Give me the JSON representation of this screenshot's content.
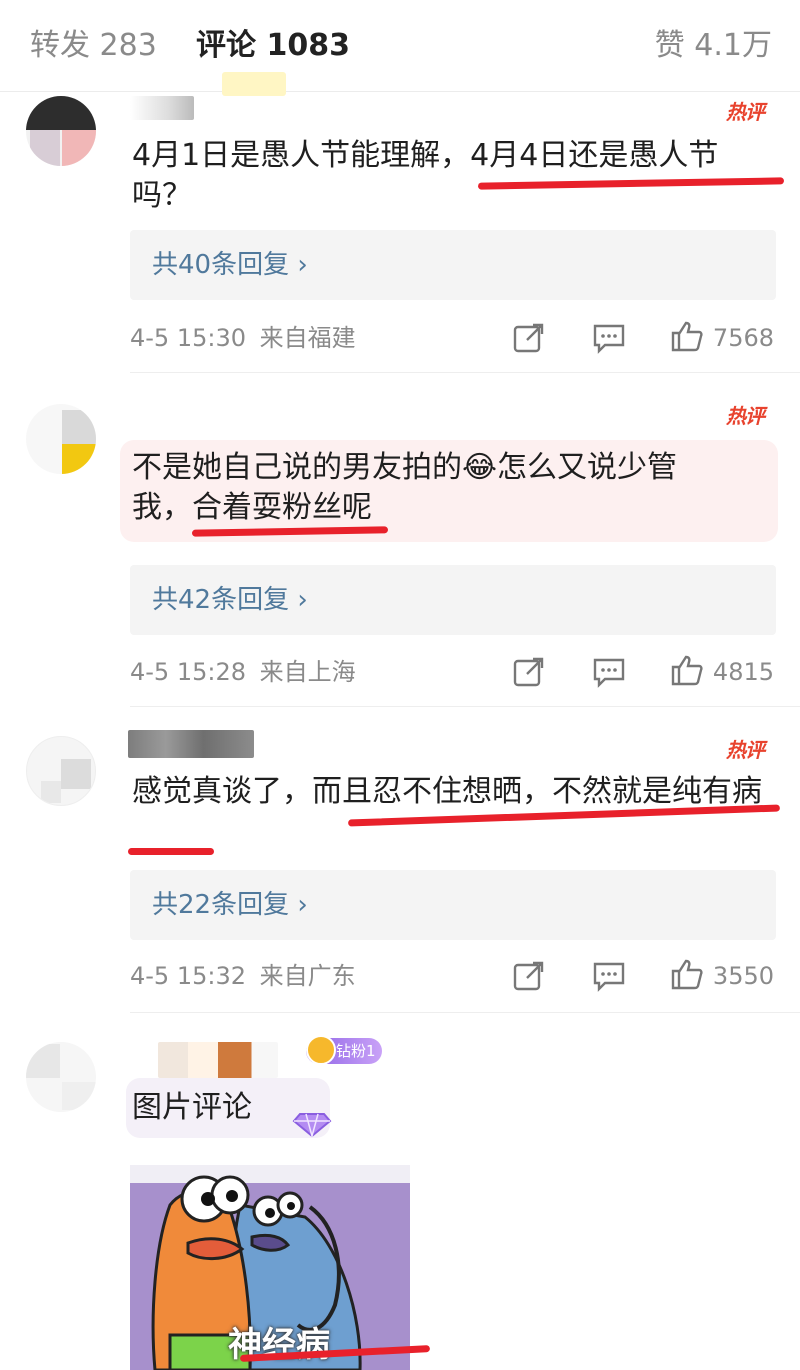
{
  "tabs": {
    "repost": "转发 283",
    "comment": "评论 1083",
    "like": "赞 4.1万"
  },
  "comments": [
    {
      "hot_badge": "热评",
      "text": "4月1日是愚人节能理解，4月4日还是愚人节吗？",
      "replies": "共40条回复 ›",
      "time": "4-5 15:30",
      "location": "来自福建",
      "likes": "7568"
    },
    {
      "hot_badge": "热评",
      "text": "不是她自己说的男友拍的😂怎么又说少管我，合着耍粉丝呢",
      "replies": "共42条回复 ›",
      "time": "4-5 15:28",
      "location": "来自上海",
      "likes": "4815"
    },
    {
      "hot_badge": "热评",
      "text": "感觉真谈了，而且忍不住想晒，不然就是纯有病",
      "replies": "共22条回复 ›",
      "time": "4-5 15:32",
      "location": "来自广东",
      "likes": "3550"
    },
    {
      "fan_badge": "钻粉1",
      "text": "图片评论",
      "image_caption": "神经病"
    }
  ],
  "colors": {
    "accent_red": "#e8212b",
    "link_blue": "#50799c",
    "meta_gray": "#8a8a8a"
  },
  "icons": [
    "share-icon",
    "comment-icon",
    "thumbs-up-icon",
    "diamond-fan-icon",
    "purple-gem-icon"
  ]
}
